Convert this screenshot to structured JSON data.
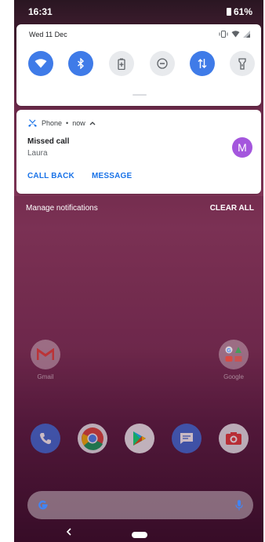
{
  "status_bar": {
    "time": "16:31",
    "battery": "61%"
  },
  "quick_settings": {
    "date": "Wed 11 Dec",
    "tiles": [
      {
        "name": "wifi",
        "state": "on"
      },
      {
        "name": "bluetooth",
        "state": "on"
      },
      {
        "name": "battery-saver",
        "state": "off"
      },
      {
        "name": "do-not-disturb",
        "state": "off"
      },
      {
        "name": "mobile-data",
        "state": "on"
      },
      {
        "name": "flashlight",
        "state": "off"
      }
    ]
  },
  "notification": {
    "app": "Phone",
    "time": "now",
    "separator": "•",
    "title": "Missed call",
    "subtitle": "Laura",
    "avatar_letter": "M",
    "avatar_color": "#a456dd",
    "actions": {
      "call_back": "CALL BACK",
      "message": "MESSAGE"
    }
  },
  "shade_footer": {
    "manage": "Manage notifications",
    "clear_all": "CLEAR ALL"
  },
  "home": {
    "apps": {
      "gmail": "Gmail",
      "google": "Google"
    },
    "dock": [
      "phone",
      "chrome",
      "play-store",
      "messages",
      "camera"
    ]
  },
  "colors": {
    "accent": "#3f7be8",
    "action": "#1a73e8"
  }
}
